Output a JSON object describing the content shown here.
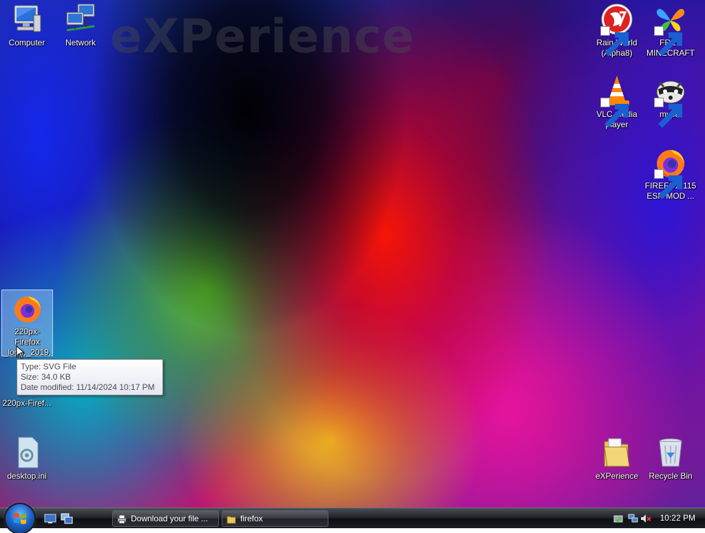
{
  "desktop": {
    "watermark": "eXPerience",
    "icons_left": [
      {
        "label": "Computer"
      },
      {
        "label": "Network"
      }
    ],
    "icons_right": [
      {
        "label": "Rain World (Alpha8)"
      },
      {
        "label": "FREE MINECRAFT"
      },
      {
        "label": "VLC media player"
      },
      {
        "label": "mypal"
      },
      {
        "label": "FIREFOX 115 ESR MOD ..."
      },
      {
        "label": "eXPerience"
      },
      {
        "label": "Recycle Bin"
      }
    ],
    "selected_file": {
      "label": "220px-Firefox _logo,_2019.s vg"
    },
    "second_file": {
      "label": "220px-Firef..."
    },
    "desktop_ini": {
      "label": "desktop.ini"
    }
  },
  "tooltip": {
    "type": "Type: SVG File",
    "size": "Size: 34.0 KB",
    "date": "Date modified: 11/14/2024 10:17 PM"
  },
  "taskbar": {
    "tasks": [
      {
        "label": "Download your file ...",
        "icon": "printer-download-icon"
      },
      {
        "label": "firefox",
        "icon": "folder-icon"
      }
    ],
    "clock": "10:22 PM"
  }
}
